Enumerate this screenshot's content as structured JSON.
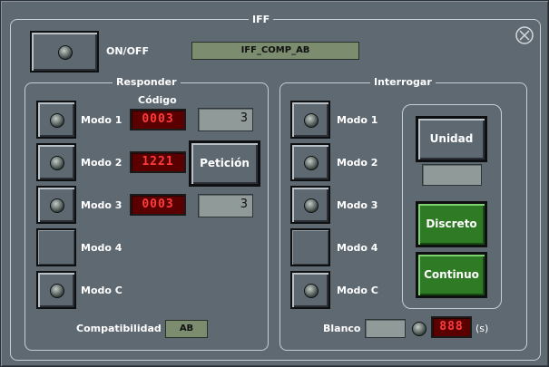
{
  "window": {
    "title": "IFF"
  },
  "power": {
    "label": "ON/OFF"
  },
  "compat_display": "IFF_COMP_AB",
  "responder": {
    "title": "Responder",
    "code_header": "Código",
    "modes": [
      {
        "label": "Modo 1",
        "code": "0003",
        "value": "3"
      },
      {
        "label": "Modo 2",
        "code": "1221"
      },
      {
        "label": "Modo 3",
        "code": "0003",
        "value": "3"
      },
      {
        "label": "Modo 4"
      },
      {
        "label": "Modo C"
      }
    ],
    "peticion_label": "Petición",
    "compat_label": "Compatibilidad",
    "compat_value": "AB"
  },
  "interrogar": {
    "title": "Interrogar",
    "modes": [
      {
        "label": "Modo 1"
      },
      {
        "label": "Modo 2"
      },
      {
        "label": "Modo 3"
      },
      {
        "label": "Modo 4"
      },
      {
        "label": "Modo C"
      }
    ],
    "unidad_label": "Unidad",
    "unidad_value": "",
    "discreto_label": "Discreto",
    "continuo_label": "Continuo",
    "blanco_label": "Blanco",
    "blanco_value": "",
    "timer": "888",
    "timer_unit": "(s)"
  },
  "colors": {
    "panel": "#5f6972",
    "led_red": "#ff3b3b",
    "green_button": "#2f7a25",
    "field_green": "#7c8c6f"
  }
}
